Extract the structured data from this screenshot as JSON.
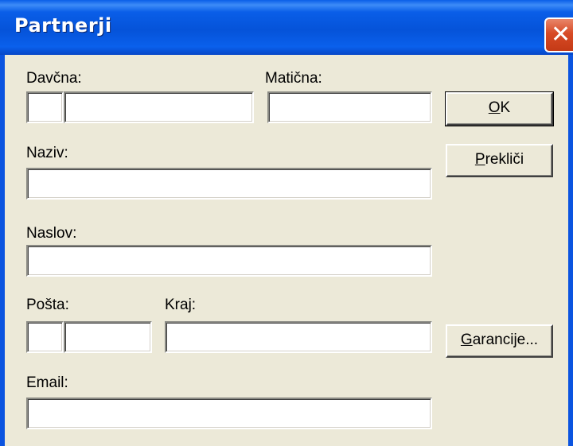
{
  "window": {
    "title": "Partnerji"
  },
  "labels": {
    "davcna": "Davčna:",
    "maticna": "Matična:",
    "naziv": "Naziv:",
    "naslov": "Naslov:",
    "posta": "Pošta:",
    "kraj": "Kraj:",
    "email": "Email:"
  },
  "fields": {
    "davcna_prefix": "",
    "davcna": "",
    "maticna": "",
    "naziv": "",
    "naslov": "",
    "posta_prefix": "",
    "posta": "",
    "kraj": "",
    "email": ""
  },
  "buttons": {
    "ok_access": "O",
    "ok_rest": "K",
    "preklici_access": "P",
    "preklici_rest": "rekliči",
    "garancije_access": "G",
    "garancije_rest": "arancije..."
  },
  "icons": {
    "close": "close-icon"
  },
  "colors": {
    "titlebar": "#0a5ee8",
    "close": "#d74a25",
    "dialog": "#ece9d8"
  }
}
